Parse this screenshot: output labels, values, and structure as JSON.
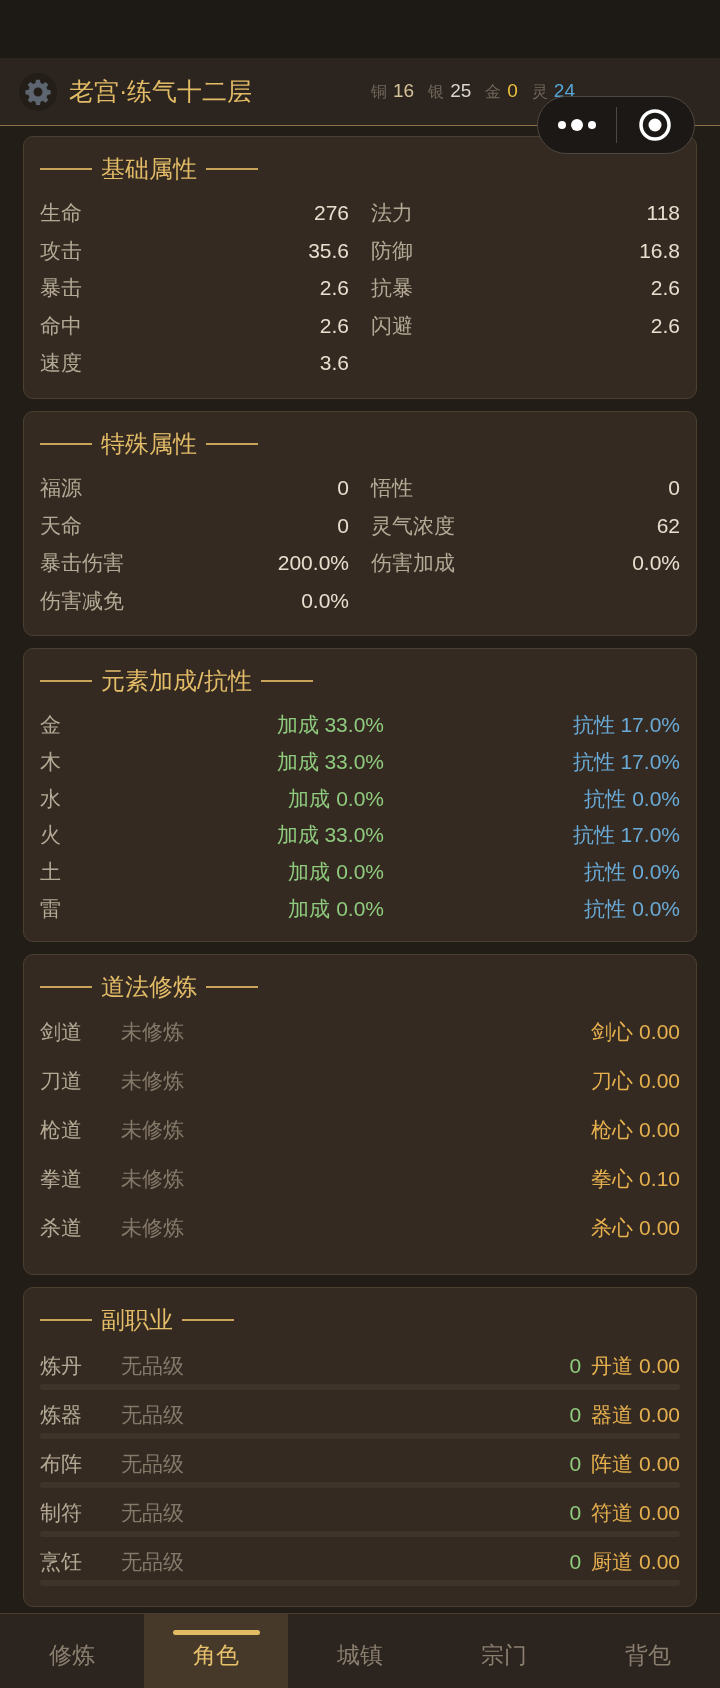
{
  "header": {
    "title": "老宫·练气十二层",
    "currencies": [
      {
        "name": "铜",
        "amount": "16",
        "color": "#d6c29a"
      },
      {
        "name": "银",
        "amount": "25",
        "color": "#d9d6cf"
      },
      {
        "name": "金",
        "amount": "0",
        "color": "#ecc23e"
      },
      {
        "name": "灵",
        "amount": "24",
        "color": "#55a6d6"
      }
    ]
  },
  "sections": [
    {
      "kind": "stats",
      "title": "基础属性",
      "items": [
        {
          "label": "生命",
          "value": "276"
        },
        {
          "label": "法力",
          "value": "118"
        },
        {
          "label": "攻击",
          "value": "35.6"
        },
        {
          "label": "防御",
          "value": "16.8"
        },
        {
          "label": "暴击",
          "value": "2.6"
        },
        {
          "label": "抗暴",
          "value": "2.6"
        },
        {
          "label": "命中",
          "value": "2.6"
        },
        {
          "label": "闪避",
          "value": "2.6"
        },
        {
          "label": "速度",
          "value": "3.6"
        }
      ]
    },
    {
      "kind": "stats",
      "title": "特殊属性",
      "items": [
        {
          "label": "福源",
          "value": "0"
        },
        {
          "label": "悟性",
          "value": "0"
        },
        {
          "label": "天命",
          "value": "0"
        },
        {
          "label": "灵气浓度",
          "value": "62"
        },
        {
          "label": "暴击伤害",
          "value": "200.0%"
        },
        {
          "label": "伤害加成",
          "value": "0.0%"
        },
        {
          "label": "伤害减免",
          "value": "0.0%"
        }
      ]
    },
    {
      "kind": "elements",
      "title": "元素加成/抗性",
      "rows": [
        {
          "element": "金",
          "bonus": "加成 33.0%",
          "resistance": "抗性 17.0%"
        },
        {
          "element": "木",
          "bonus": "加成 33.0%",
          "resistance": "抗性 17.0%"
        },
        {
          "element": "水",
          "bonus": "加成 0.0%",
          "resistance": "抗性 0.0%"
        },
        {
          "element": "火",
          "bonus": "加成 33.0%",
          "resistance": "抗性 17.0%"
        },
        {
          "element": "土",
          "bonus": "加成 0.0%",
          "resistance": "抗性 0.0%"
        },
        {
          "element": "雷",
          "bonus": "加成 0.0%",
          "resistance": "抗性 0.0%"
        }
      ]
    },
    {
      "kind": "cultivation",
      "title": "道法修炼",
      "rows": [
        {
          "name": "剑道",
          "status": "未修炼",
          "value": "剑心 0.00"
        },
        {
          "name": "刀道",
          "status": "未修炼",
          "value": "刀心 0.00"
        },
        {
          "name": "枪道",
          "status": "未修炼",
          "value": "枪心 0.00"
        },
        {
          "name": "拳道",
          "status": "未修炼",
          "value": "拳心 0.10"
        },
        {
          "name": "杀道",
          "status": "未修炼",
          "value": "杀心 0.00"
        }
      ]
    },
    {
      "kind": "professions",
      "title": "副职业",
      "rows": [
        {
          "name": "炼丹",
          "grade": "无品级",
          "count": "0",
          "value": "丹道 0.00"
        },
        {
          "name": "炼器",
          "grade": "无品级",
          "count": "0",
          "value": "器道 0.00"
        },
        {
          "name": "布阵",
          "grade": "无品级",
          "count": "0",
          "value": "阵道 0.00"
        },
        {
          "name": "制符",
          "grade": "无品级",
          "count": "0",
          "value": "符道 0.00"
        },
        {
          "name": "烹饪",
          "grade": "无品级",
          "count": "0",
          "value": "厨道 0.00"
        }
      ]
    }
  ],
  "nav": [
    {
      "label": "修炼",
      "selected": false
    },
    {
      "label": "角色",
      "selected": true
    },
    {
      "label": "城镇",
      "selected": false
    },
    {
      "label": "宗门",
      "selected": false
    },
    {
      "label": "背包",
      "selected": false
    }
  ]
}
